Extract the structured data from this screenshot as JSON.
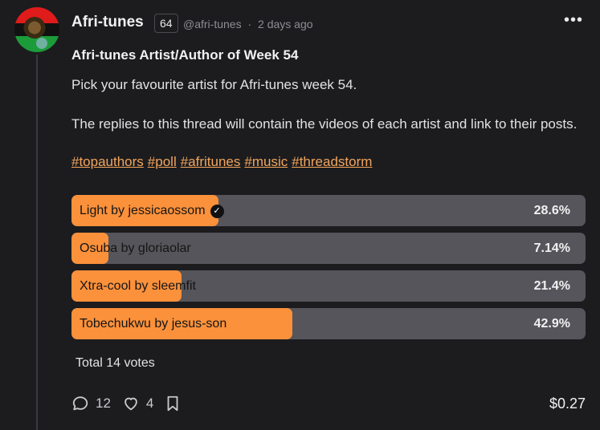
{
  "post": {
    "author": "Afri-tunes",
    "reputation": "64",
    "handle": "@afri-tunes",
    "separator": "·",
    "time": "2 days ago",
    "title": "Afri-tunes Artist/Author of Week 54",
    "paragraph1": "Pick your favourite artist for Afri-tunes week 54.",
    "paragraph2": "The replies to this thread will contain the videos of each artist and link to their posts.",
    "tags": [
      "#topauthors",
      "#poll",
      "#afritunes",
      "#music",
      "#threadstorm"
    ]
  },
  "poll": {
    "options": [
      {
        "label": "Light by jessicaossom",
        "percent": "28.6%",
        "fraction": 0.286,
        "voted": true
      },
      {
        "label": "Osuba by gloriaolar",
        "percent": "7.14%",
        "fraction": 0.0714,
        "voted": false
      },
      {
        "label": "Xtra-cool by sleemfit",
        "percent": "21.4%",
        "fraction": 0.214,
        "voted": false
      },
      {
        "label": "Tobechukwu by jesus-son",
        "percent": "42.9%",
        "fraction": 0.429,
        "voted": false
      }
    ],
    "total": "Total 14 votes"
  },
  "actions": {
    "comments": "12",
    "likes": "4",
    "payout": "$0.27"
  },
  "colors": {
    "background": "#1c1c1f",
    "bar_track": "#55555b",
    "bar_fill": "#fb913b",
    "tag": "#f2a55c"
  }
}
